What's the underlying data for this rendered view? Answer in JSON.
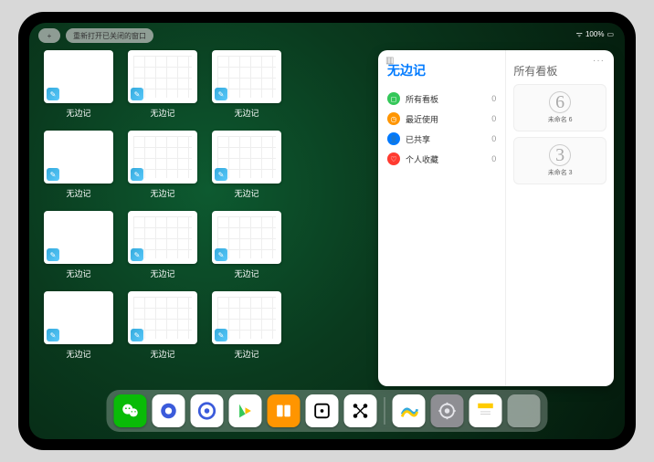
{
  "status": {
    "battery": "100%",
    "wifi": "●●●"
  },
  "toolbar": {
    "plus": "+",
    "reopen": "重新打开已关闭的窗口"
  },
  "thumbs": {
    "label": "无边记",
    "items": [
      {
        "grid": false
      },
      {
        "grid": true
      },
      {
        "grid": true
      },
      {
        "grid": false
      },
      {
        "grid": true
      },
      {
        "grid": true
      },
      {
        "grid": false
      },
      {
        "grid": true
      },
      {
        "grid": true
      },
      {
        "grid": false
      },
      {
        "grid": true
      },
      {
        "grid": true
      }
    ]
  },
  "panel": {
    "title": "无边记",
    "more": "···",
    "rows": [
      {
        "icon": "◻",
        "color": "#34c759",
        "label": "所有看板",
        "count": "0"
      },
      {
        "icon": "◷",
        "color": "#ff9500",
        "label": "最近使用",
        "count": "0"
      },
      {
        "icon": "👤",
        "color": "#007aff",
        "label": "已共享",
        "count": "0"
      },
      {
        "icon": "♡",
        "color": "#ff3b30",
        "label": "个人收藏",
        "count": "0"
      }
    ],
    "right_title": "所有看板",
    "boards": [
      {
        "sketch": "6",
        "label": "未命名 6"
      },
      {
        "sketch": "3",
        "label": "未命名 3"
      }
    ]
  },
  "dock": [
    {
      "name": "wechat",
      "bg": "#09bb07",
      "glyph": "wechat"
    },
    {
      "name": "quark-hd",
      "bg": "#fff",
      "glyph": "quark"
    },
    {
      "name": "quark",
      "bg": "#fff",
      "glyph": "quark2"
    },
    {
      "name": "play",
      "bg": "#fff",
      "glyph": "play"
    },
    {
      "name": "books",
      "bg": "#ff9500",
      "glyph": "books"
    },
    {
      "name": "roll",
      "bg": "#fff",
      "glyph": "die"
    },
    {
      "name": "share",
      "bg": "#fff",
      "glyph": "nodes"
    },
    {
      "name": "freeform",
      "bg": "#fff",
      "glyph": "freeform"
    },
    {
      "name": "settings",
      "bg": "#8e8e93",
      "glyph": "gear"
    },
    {
      "name": "notes",
      "bg": "#fff",
      "glyph": "notes"
    }
  ]
}
